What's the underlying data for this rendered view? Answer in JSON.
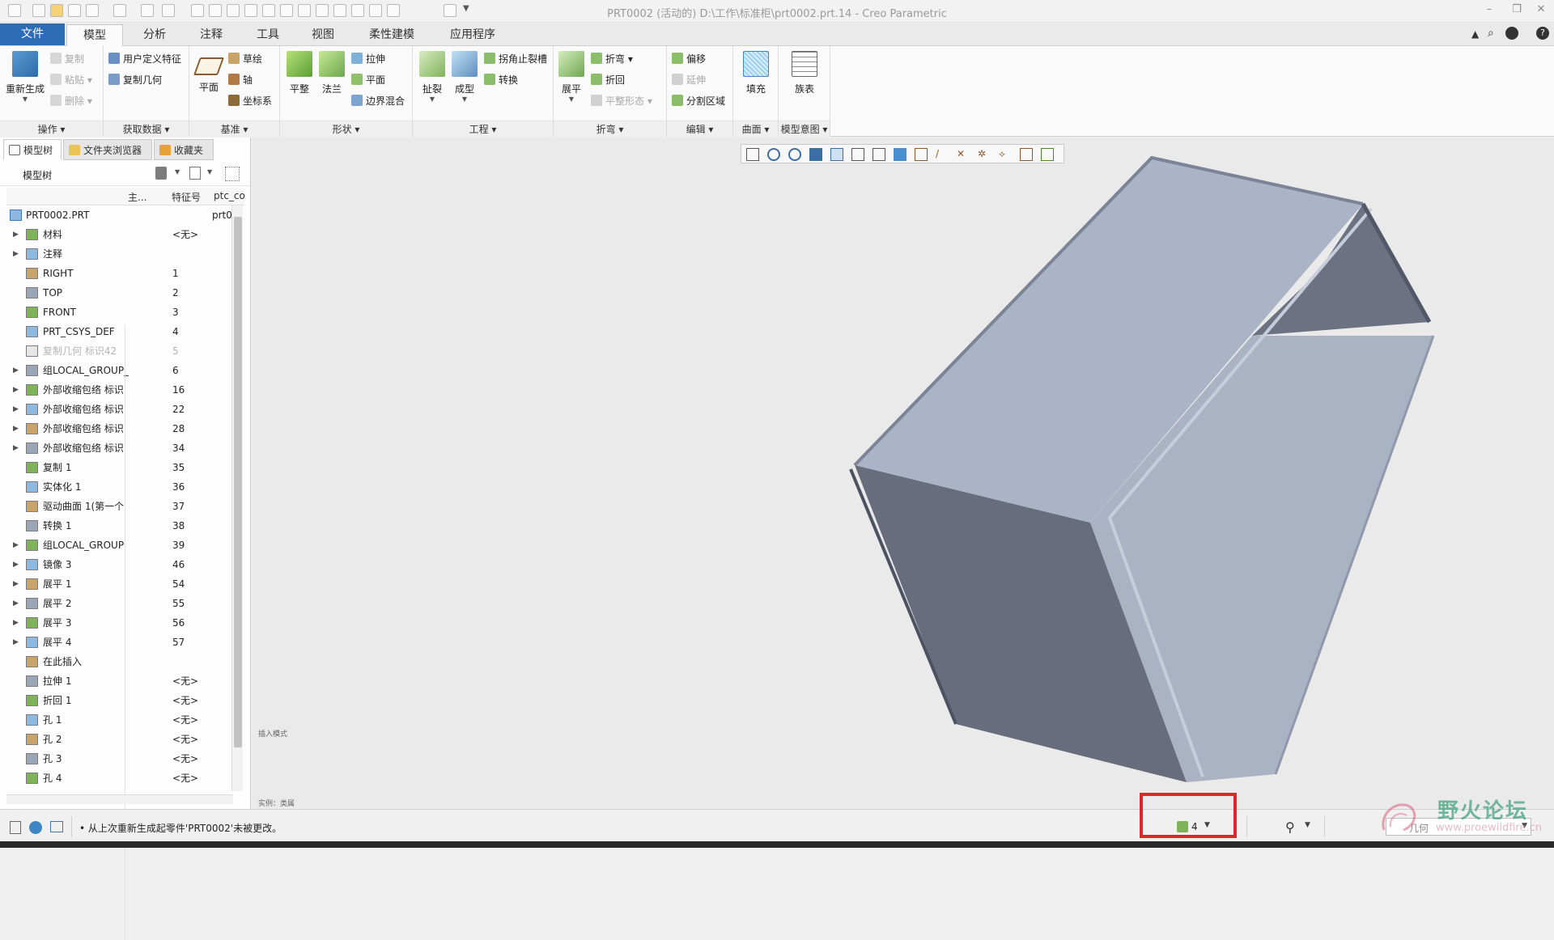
{
  "window": {
    "title": "PRT0002 (活动的) D:\\工作\\标准柜\\prt0002.prt.14 - Creo Parametric"
  },
  "tabs": [
    {
      "label": "文件"
    },
    {
      "label": "模型"
    },
    {
      "label": "分析"
    },
    {
      "label": "注释"
    },
    {
      "label": "工具"
    },
    {
      "label": "视图"
    },
    {
      "label": "柔性建模"
    },
    {
      "label": "应用程序"
    }
  ],
  "ribbon": {
    "operations": {
      "label": "操作",
      "regenerate": "重新生成",
      "copy": "复制",
      "paste": "粘贴",
      "delete": "删除"
    },
    "get_data": {
      "label": "获取数据",
      "udf": "用户定义特征",
      "copy_geom": "复制几何"
    },
    "datum": {
      "label": "基准",
      "plane": "平面",
      "sketch": "草绘",
      "axis": "轴",
      "csys": "坐标系"
    },
    "shapes": {
      "label": "形状",
      "flat": "平整",
      "flange": "法兰",
      "extrude": "拉伸",
      "planar": "平面",
      "boundary": "边界混合"
    },
    "engineering": {
      "label": "工程",
      "rip": "扯裂",
      "form": "成型",
      "corner_relief": "拐角止裂槽",
      "convert": "转换"
    },
    "bends": {
      "label": "折弯",
      "unbend": "展平",
      "bend": "折弯",
      "bend_back": "折回",
      "flat_state": "平整形态"
    },
    "editing": {
      "label": "编辑",
      "offset": "偏移",
      "extend": "延伸",
      "split_area": "分割区域"
    },
    "surfaces": {
      "label": "曲面",
      "fill": "填充"
    },
    "model_intent": {
      "label": "模型意图",
      "family_table": "族表"
    }
  },
  "navigator": {
    "tabs": [
      "模型树",
      "文件夹浏览器",
      "收藏夹"
    ],
    "tree_title": "模型树",
    "columns": [
      "主...",
      "特征号",
      "ptc_co"
    ],
    "root": {
      "name": "PRT0002.PRT",
      "extra": "prt0"
    },
    "items": [
      {
        "name": "材料",
        "id": "<无>",
        "expand": true
      },
      {
        "name": "注释",
        "id": "",
        "expand": true
      },
      {
        "name": "RIGHT",
        "id": "1",
        "expand": false
      },
      {
        "name": "TOP",
        "id": "2",
        "expand": false
      },
      {
        "name": "FRONT",
        "id": "3",
        "expand": false
      },
      {
        "name": "PRT_CSYS_DEF",
        "id": "4",
        "expand": false
      },
      {
        "name": "复制几何 标识42",
        "id": "5",
        "expand": false,
        "dim": true
      },
      {
        "name": "组LOCAL_GROUP_",
        "id": "6",
        "expand": true
      },
      {
        "name": "外部收缩包络 标识",
        "id": "16",
        "expand": true
      },
      {
        "name": "外部收缩包络 标识",
        "id": "22",
        "expand": true
      },
      {
        "name": "外部收缩包络 标识",
        "id": "28",
        "expand": true
      },
      {
        "name": "外部收缩包络 标识",
        "id": "34",
        "expand": true
      },
      {
        "name": "复制 1",
        "id": "35",
        "expand": false
      },
      {
        "name": "实体化 1",
        "id": "36",
        "expand": false
      },
      {
        "name": "驱动曲面 1(第一个",
        "id": "37",
        "expand": false
      },
      {
        "name": "转换 1",
        "id": "38",
        "expand": false
      },
      {
        "name": "组LOCAL_GROUP",
        "id": "39",
        "expand": true
      },
      {
        "name": "镜像 3",
        "id": "46",
        "expand": true
      },
      {
        "name": "展平 1",
        "id": "54",
        "expand": true
      },
      {
        "name": "展平 2",
        "id": "55",
        "expand": true
      },
      {
        "name": "展平 3",
        "id": "56",
        "expand": true
      },
      {
        "name": "展平 4",
        "id": "57",
        "expand": true
      },
      {
        "name": "在此插入",
        "id": "",
        "expand": false
      },
      {
        "name": "拉伸 1",
        "id": "<无>",
        "expand": false
      },
      {
        "name": "折回 1",
        "id": "<无>",
        "expand": false
      },
      {
        "name": "孔 1",
        "id": "<无>",
        "expand": false
      },
      {
        "name": "孔 2",
        "id": "<无>",
        "expand": false
      },
      {
        "name": "孔 3",
        "id": "<无>",
        "expand": false
      },
      {
        "name": "孔 4",
        "id": "<无>",
        "expand": false
      }
    ]
  },
  "graphics": {
    "mode_label": "插入模式",
    "instance_label": "实例：类属"
  },
  "status": {
    "message": "从上次重新生成起零件'PRT0002'未被更改。",
    "regen_count": "4",
    "filter": "几何"
  },
  "watermark": {
    "text": "野火论坛",
    "url": "www.proewildfire.cn"
  },
  "colors": {
    "accent": "#2c6db5",
    "highlight": "#e0262a",
    "model_light": "#aab4c6",
    "model_dark": "#6a7080"
  }
}
